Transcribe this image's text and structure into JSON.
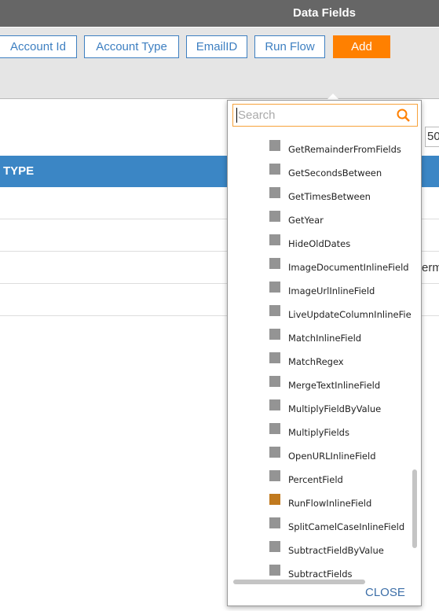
{
  "header": {
    "title": "Data Fields"
  },
  "toolbar": {
    "buttons": [
      "Account Id",
      "Account Type",
      "EmailID",
      "Run Flow"
    ],
    "add_label": "Add"
  },
  "page_size_value": "50",
  "table": {
    "column_header": "TYPE",
    "partial_cell_text": "erm"
  },
  "popup": {
    "search_placeholder": "Search",
    "items": [
      {
        "label": "GetRemainderFromFields",
        "color": "#949494"
      },
      {
        "label": "GetSecondsBetween",
        "color": "#949494"
      },
      {
        "label": "GetTimesBetween",
        "color": "#949494"
      },
      {
        "label": "GetYear",
        "color": "#949494"
      },
      {
        "label": "HideOldDates",
        "color": "#949494"
      },
      {
        "label": "ImageDocumentInlineField",
        "color": "#949494"
      },
      {
        "label": "ImageUrlInlineField",
        "color": "#949494"
      },
      {
        "label": "LiveUpdateColumnInlineField",
        "color": "#949494"
      },
      {
        "label": "MatchInlineField",
        "color": "#949494"
      },
      {
        "label": "MatchRegex",
        "color": "#949494"
      },
      {
        "label": "MergeTextInlineField",
        "color": "#949494"
      },
      {
        "label": "MultiplyFieldByValue",
        "color": "#949494"
      },
      {
        "label": "MultiplyFields",
        "color": "#949494"
      },
      {
        "label": "OpenURLInlineField",
        "color": "#949494"
      },
      {
        "label": "PercentField",
        "color": "#949494"
      },
      {
        "label": "RunFlowInlineField",
        "color": "#c17a1f"
      },
      {
        "label": "SplitCamelCaseInlineField",
        "color": "#949494"
      },
      {
        "label": "SubtractFieldByValue",
        "color": "#949494"
      },
      {
        "label": "SubtractFields",
        "color": "#949494"
      }
    ],
    "close_label": "CLOSE"
  }
}
